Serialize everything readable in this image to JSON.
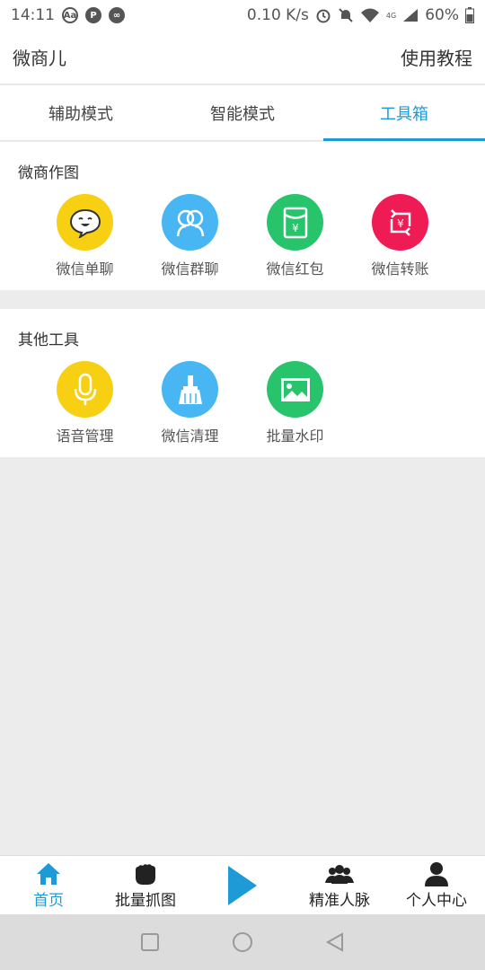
{
  "status": {
    "time": "14:11",
    "net_speed": "0.10 K/s",
    "battery": "60%",
    "icons": [
      "translate-icon",
      "p-icon",
      "loop-icon",
      "alarm-icon",
      "mute-icon",
      "wifi-icon",
      "signal-icon",
      "battery-icon"
    ],
    "lte_label": "4G"
  },
  "appbar": {
    "title": "微商儿",
    "help_label": "使用教程"
  },
  "tabs": [
    {
      "label": "辅助模式"
    },
    {
      "label": "智能模式"
    },
    {
      "label": "工具箱",
      "active": true
    }
  ],
  "sections": [
    {
      "title": "微商作图",
      "tools": [
        {
          "label": "微信单聊",
          "icon": "chat-face-icon",
          "color": "#f7cf13"
        },
        {
          "label": "微信群聊",
          "icon": "group-chat-icon",
          "color": "#47b6f2"
        },
        {
          "label": "微信红包",
          "icon": "red-packet-icon",
          "color": "#27c46b"
        },
        {
          "label": "微信转账",
          "icon": "transfer-icon",
          "color": "#ef1b55"
        }
      ]
    },
    {
      "title": "其他工具",
      "tools": [
        {
          "label": "语音管理",
          "icon": "microphone-icon",
          "color": "#f7cf13"
        },
        {
          "label": "微信清理",
          "icon": "broom-icon",
          "color": "#47b6f2"
        },
        {
          "label": "批量水印",
          "icon": "image-icon",
          "color": "#27c46b"
        }
      ]
    }
  ],
  "bottomnav": [
    {
      "label": "首页",
      "icon": "home-icon",
      "active": true
    },
    {
      "label": "批量抓图",
      "icon": "grab-hand-icon"
    },
    {
      "label": "",
      "icon": "play-icon"
    },
    {
      "label": "精准人脉",
      "icon": "people-icon"
    },
    {
      "label": "个人中心",
      "icon": "person-icon"
    }
  ],
  "colors": {
    "accent": "#1e9bd7",
    "yellow": "#f7cf13",
    "blue": "#47b6f2",
    "green": "#27c46b",
    "red": "#ef1b55"
  }
}
